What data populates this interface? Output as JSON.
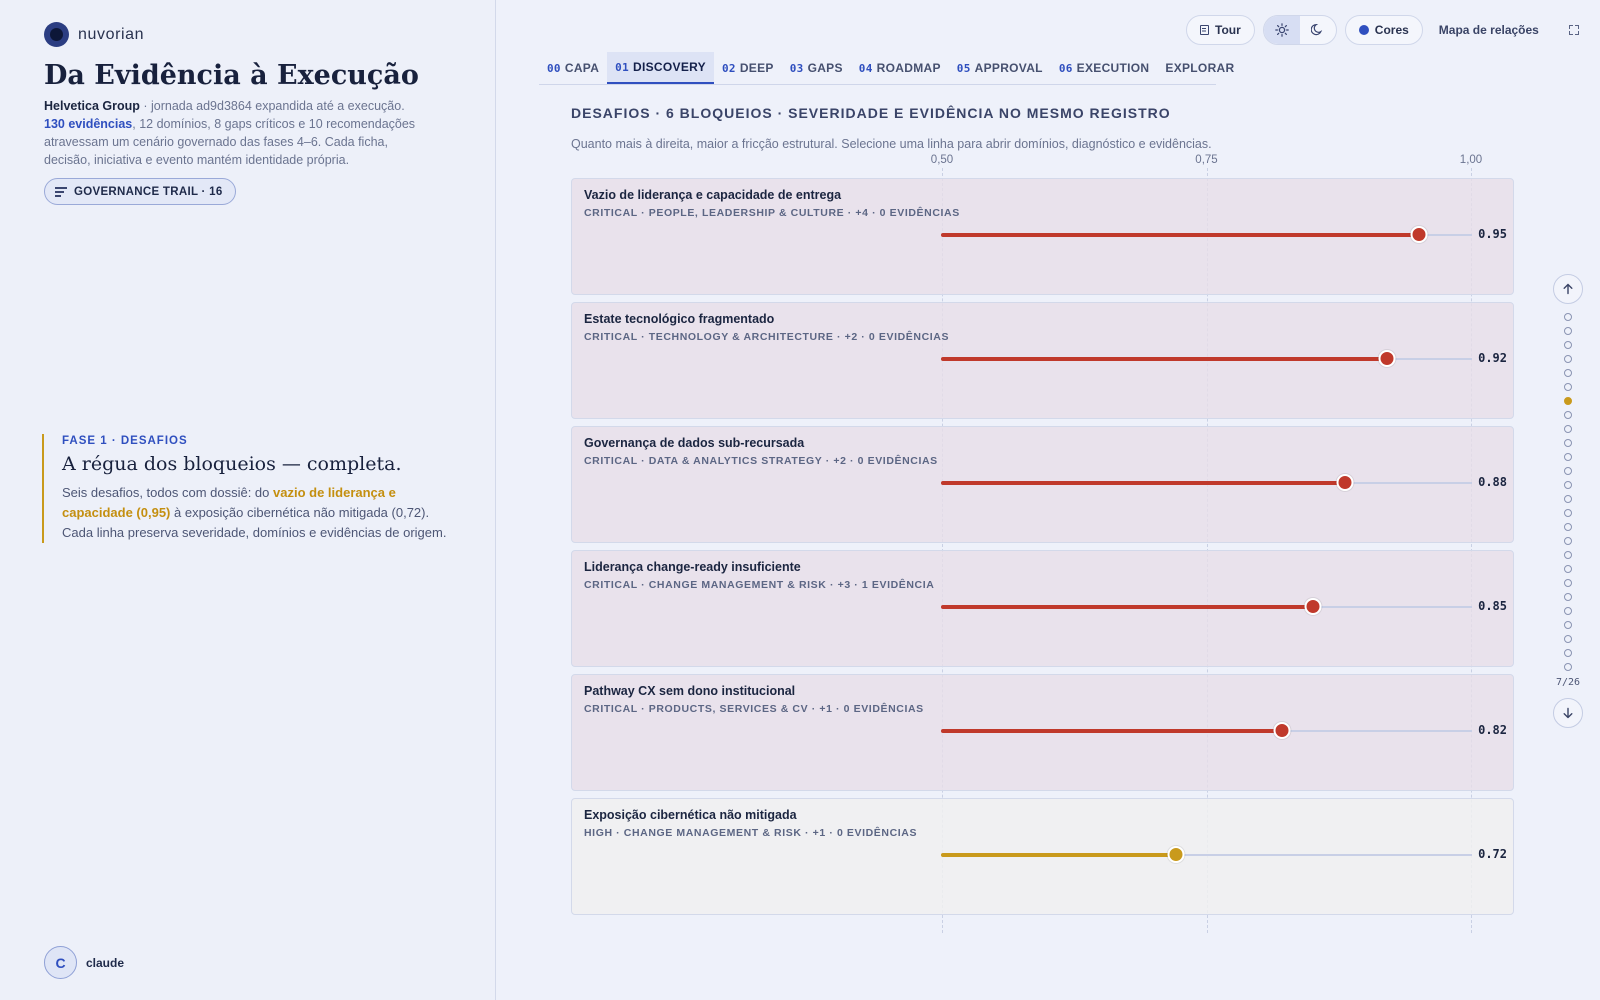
{
  "brand": {
    "name": "nuvorian"
  },
  "sidebar": {
    "title": "Da Evidência à Execução",
    "intro": {
      "company": "Helvetica Group",
      "journey_text": " · jornada ad9d3864 expandida até a execução.",
      "evidence_count": "130 evidências",
      "rest_text": ", 12 domínios, 8 gaps críticos e 10 recomendações atravessam um cenário governado das fases 4–6. Cada ficha, decisão, iniciativa e evento mantém identidade própria."
    },
    "trail_button": "GOVERNANCE TRAIL · 16",
    "phase": {
      "kicker": "FASE 1 · DESAFIOS",
      "title": "A régua dos bloqueios — completa.",
      "body_pre": "Seis desafios, todos com dossiê: do ",
      "body_highlight": "vazio de liderança e capacidade (0,95)",
      "body_post": " à exposição cibernética não mitigada (0,72). Cada linha preserva severidade, domínios e evidências de origem."
    },
    "user": {
      "initial": "C",
      "name": "claude"
    }
  },
  "topbar": {
    "tour": "Tour",
    "colors": "Cores",
    "map": "Mapa de relações"
  },
  "tabs": [
    {
      "num": "00",
      "label": "CAPA"
    },
    {
      "num": "01",
      "label": "DISCOVERY",
      "active": true
    },
    {
      "num": "02",
      "label": "DEEP"
    },
    {
      "num": "03",
      "label": "GAPS"
    },
    {
      "num": "04",
      "label": "ROADMAP"
    },
    {
      "num": "05",
      "label": "APPROVAL"
    },
    {
      "num": "06",
      "label": "EXECUTION"
    },
    {
      "num": "",
      "label": "EXPLORAR"
    }
  ],
  "section": {
    "title": "DESAFIOS · 6 BLOQUEIOS · SEVERIDADE E EVIDÊNCIA NO MESMO REGISTRO",
    "subtitle": "Quanto mais à direita, maior a fricção estrutural. Selecione uma linha para abrir domínios, diagnóstico e evidências."
  },
  "chart_data": {
    "type": "bar",
    "xlim": [
      0.5,
      1.0
    ],
    "ticks": [
      {
        "value": 0.5,
        "label": "0,50"
      },
      {
        "value": 0.75,
        "label": "0,75"
      },
      {
        "value": 1.0,
        "label": "1,00"
      }
    ],
    "colors": {
      "critical": "#c0392b",
      "high": "#c99a1c"
    },
    "rows": [
      {
        "title": "Vazio de liderança e capacidade de entrega",
        "meta": "CRITICAL · PEOPLE, LEADERSHIP & CULTURE · +4 · 0 EVIDÊNCIAS",
        "severity": "critical",
        "value": 0.95,
        "label": "0.95"
      },
      {
        "title": "Estate tecnológico fragmentado",
        "meta": "CRITICAL · TECHNOLOGY & ARCHITECTURE · +2 · 0 EVIDÊNCIAS",
        "severity": "critical",
        "value": 0.92,
        "label": "0.92"
      },
      {
        "title": "Governança de dados sub-recursada",
        "meta": "CRITICAL · DATA & ANALYTICS STRATEGY · +2 · 0 EVIDÊNCIAS",
        "severity": "critical",
        "value": 0.88,
        "label": "0.88"
      },
      {
        "title": "Liderança change-ready insuficiente",
        "meta": "CRITICAL · CHANGE MANAGEMENT & RISK · +3 · 1 EVIDÊNCIA",
        "severity": "critical",
        "value": 0.85,
        "label": "0.85"
      },
      {
        "title": "Pathway CX sem dono institucional",
        "meta": "CRITICAL · PRODUCTS, SERVICES & CV · +1 · 0 EVIDÊNCIAS",
        "severity": "critical",
        "value": 0.82,
        "label": "0.82"
      },
      {
        "title": "Exposição cibernética não mitigada",
        "meta": "HIGH · CHANGE MANAGEMENT & RISK · +1 · 0 EVIDÊNCIAS",
        "severity": "high",
        "value": 0.72,
        "label": "0.72"
      }
    ]
  },
  "pager": {
    "total": 26,
    "current": 7,
    "label": "7/26"
  }
}
